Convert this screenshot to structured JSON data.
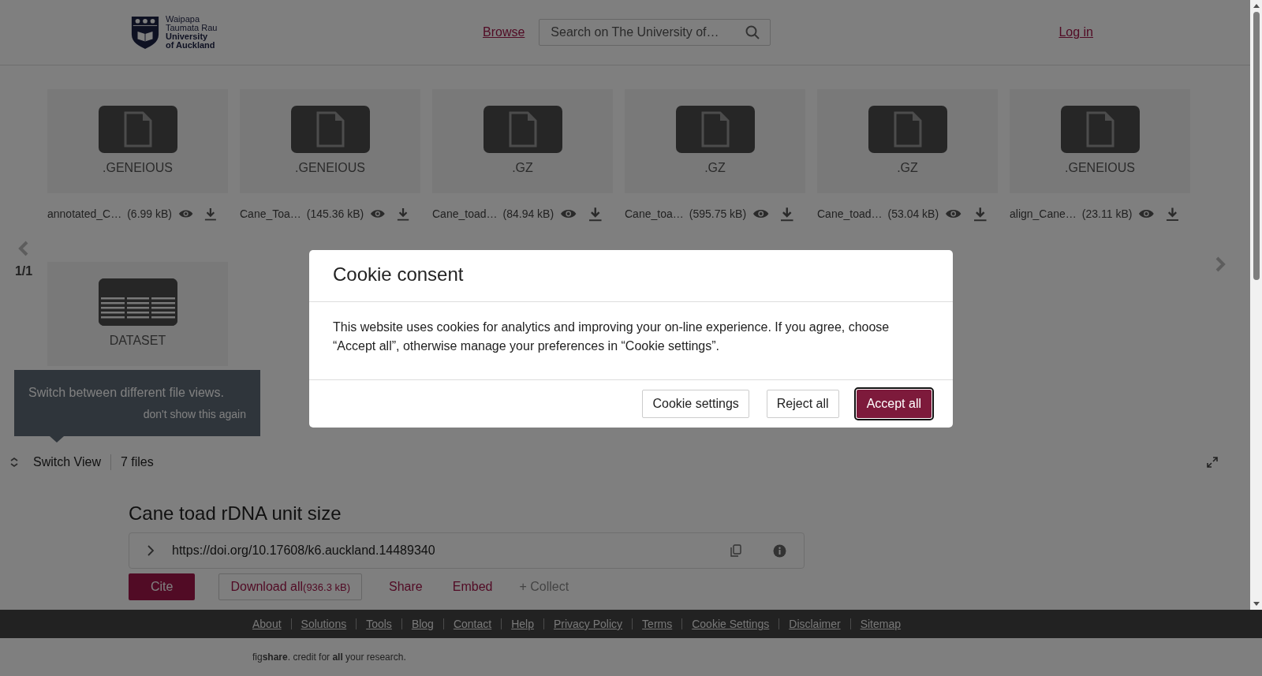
{
  "header": {
    "logo_lines": [
      "Waipapa",
      "Taumata Rau",
      "University",
      "of Auckland"
    ],
    "browse": "Browse",
    "search": {
      "placeholder": "Search on The University of…"
    },
    "login": "Log in"
  },
  "files": [
    {
      "kind": "file",
      "ext": ".GENEIOUS",
      "name": "annotated_C…",
      "size": "(6.99 kB)"
    },
    {
      "kind": "file",
      "ext": ".GENEIOUS",
      "name": "Cane_Toa…",
      "size": "(145.36 kB)"
    },
    {
      "kind": "file",
      "ext": ".GZ",
      "name": "Cane_toad…",
      "size": "(84.94 kB)"
    },
    {
      "kind": "file",
      "ext": ".GZ",
      "name": "Cane_toa…",
      "size": "(595.75 kB)"
    },
    {
      "kind": "file",
      "ext": ".GZ",
      "name": "Cane_toad…",
      "size": "(53.04 kB)"
    },
    {
      "kind": "file",
      "ext": ".GENEIOUS",
      "name": "align_Cane…",
      "size": "(23.11 kB)"
    },
    {
      "kind": "dataset",
      "ext": "DATASET"
    }
  ],
  "pager": "1/1",
  "tooltip": {
    "text": "Switch between different file views.",
    "dismiss": "don't show this again"
  },
  "toolbar": {
    "switch_view": "Switch View",
    "count": "7 files"
  },
  "title": "Cane toad rDNA unit size",
  "doi": "https://doi.org/10.17608/k6.auckland.14489340",
  "actions": [
    {
      "kind": "primary",
      "label": "Cite"
    },
    {
      "kind": "outline",
      "label": "Download all",
      "detail": "(936.3 kB)"
    },
    {
      "kind": "link",
      "label": "Share"
    },
    {
      "kind": "link",
      "label": "Embed"
    },
    {
      "kind": "muted",
      "label": "+ Collect"
    }
  ],
  "footer_links": [
    "About",
    "Solutions",
    "Tools",
    "Blog",
    "Contact",
    "Help",
    "Privacy Policy",
    "Terms",
    "Cookie Settings",
    "Disclaimer",
    "Sitemap"
  ],
  "tagline": "fig**share**. credit for **all** your research.",
  "modal": {
    "title": "Cookie consent",
    "body": "This website uses cookies for analytics and improving your on-line experience. If you agree, choose “Accept all”, otherwise manage your preferences in “Cookie settings”.",
    "buttons": [
      {
        "kind": "secondary",
        "label": "Cookie settings"
      },
      {
        "kind": "secondary",
        "label": "Reject all"
      },
      {
        "kind": "primary",
        "label": "Accept all"
      }
    ]
  }
}
